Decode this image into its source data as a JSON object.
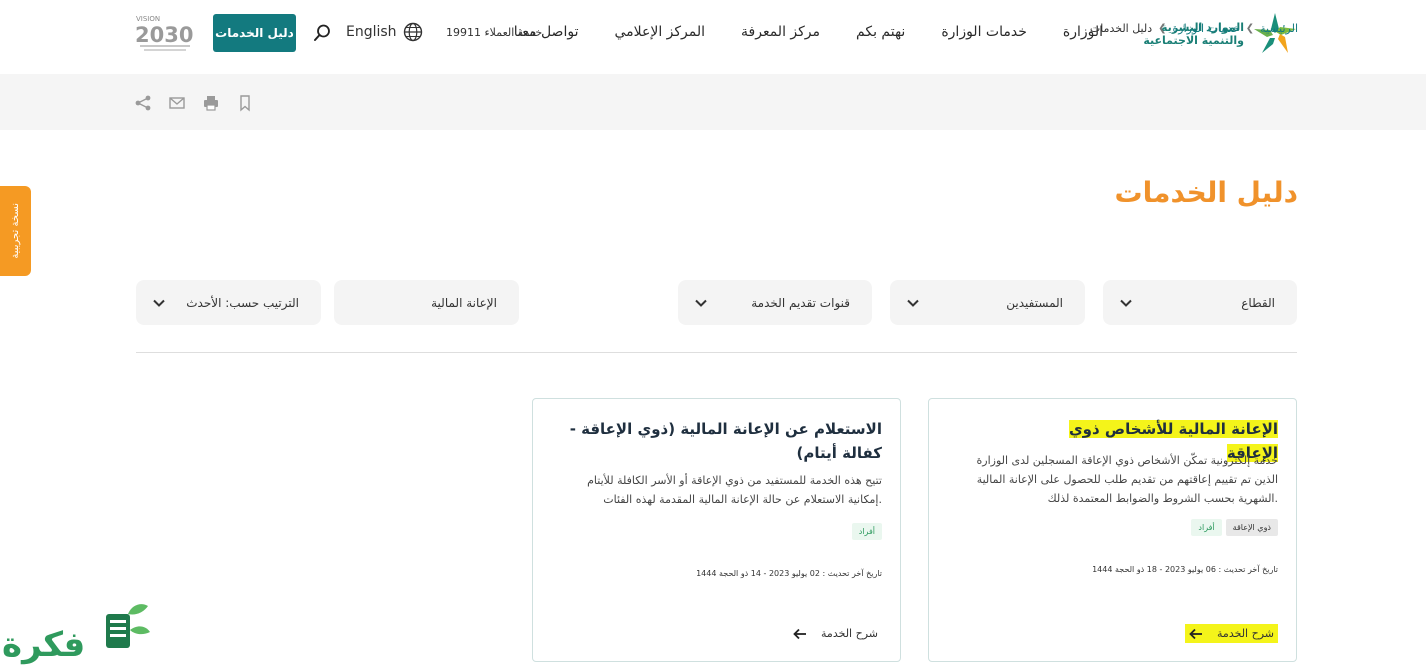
{
  "header": {
    "logo_line1": "الموارد البشرية",
    "logo_line2": "والتنمية الاجتماعية",
    "nav": [
      "الوزارة",
      "خدمات الوزارة",
      "نهتم بكم",
      "مركز المعرفة",
      "المركز الإعلامي",
      "تواصل معنا"
    ],
    "hotline": "خدمة العملاء 19911",
    "language": "English",
    "guide_button": "دليل الخدمات",
    "vision_label": "VISION 2030"
  },
  "breadcrumb": {
    "home": "الرئيسية",
    "section": "خدمات الوزارة",
    "current": "دليل الخدمات"
  },
  "beta_tab": "نسخة تجريبية",
  "page_title": "دليل الخدمات",
  "filters": {
    "sector": "القطاع",
    "beneficiaries": "المستفيدين",
    "channels": "قنوات تقديم الخدمة",
    "keyword": "الإعانة المالية",
    "sort": "الترتيب حسب: الأحدث"
  },
  "cards": [
    {
      "title": "الإعانة المالية للأشخاص ذوي الإعاقة",
      "description": "خدمة إلكترونية تمكّن الأشخاص ذوي الإعاقة المسجلين لدى الوزارة الذين تم تقييم إعاقتهم من تقديم طلب للحصول على الإعانة المالية الشهرية بحسب الشروط والضوابط المعتمدة لذلك.",
      "tags": [
        "ذوي الإعاقة",
        "أفراد"
      ],
      "updated": "تاريخ آخر تحديث : 06 يوليو 2023 - 18 ذو الحجة 1444",
      "link": "شرح الخدمة"
    },
    {
      "title": "الاستعلام عن الإعانة المالية (ذوي الإعاقة - كفالة أيتام)",
      "description": "تتيح هذه الخدمة للمستفيد من ذوي الإعاقة أو الأسر الكافلة للأيتام إمكانية الاستعلام عن حالة الإعانة المالية المقدمة لهذه الفئات.",
      "tags": [
        "أفراد"
      ],
      "updated": "تاريخ آخر تحديث : 02 يوليو 2023 - 14 ذو الحجة 1444",
      "link": "شرح الخدمة"
    }
  ],
  "watermark": "فكرة",
  "colors": {
    "brand_teal": "#137a7f",
    "title_orange": "#f0922b",
    "beta_orange": "#f59a23",
    "highlight": "#f4f41a",
    "tag_green": "#2c9a5e"
  }
}
